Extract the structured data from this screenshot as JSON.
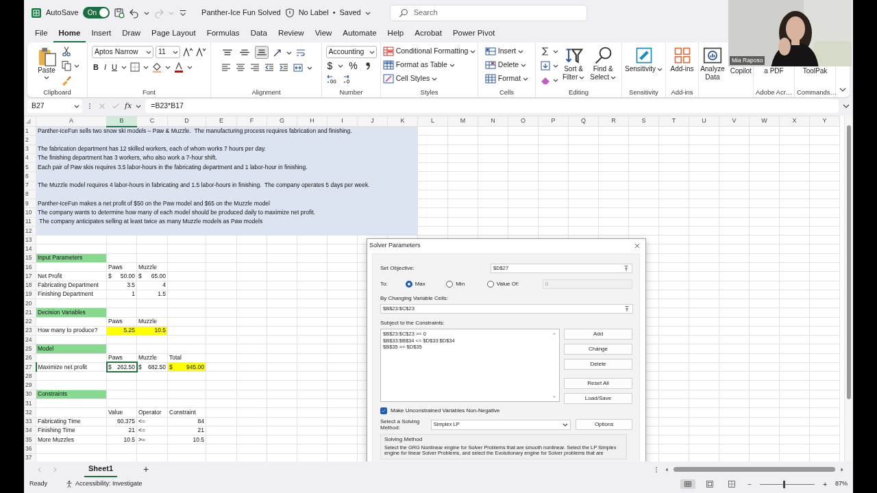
{
  "title_bar": {
    "autosave_label": "AutoSave",
    "autosave": {
      "on": true,
      "text": "On"
    },
    "file_name": "Panther-Ice Fun Solved",
    "sensitivity_label": "No Label",
    "separator": "•",
    "save_status": "Saved",
    "search": {
      "placeholder": "Search"
    }
  },
  "menu_tabs": [
    {
      "label": "File",
      "selected": false
    },
    {
      "label": "Home",
      "selected": true
    },
    {
      "label": "Insert",
      "selected": false
    },
    {
      "label": "Draw",
      "selected": false
    },
    {
      "label": "Page Layout",
      "selected": false
    },
    {
      "label": "Formulas",
      "selected": false
    },
    {
      "label": "Data",
      "selected": false
    },
    {
      "label": "Review",
      "selected": false
    },
    {
      "label": "View",
      "selected": false
    },
    {
      "label": "Automate",
      "selected": false
    },
    {
      "label": "Help",
      "selected": false
    },
    {
      "label": "Acrobat",
      "selected": false
    },
    {
      "label": "Power Pivot",
      "selected": false
    }
  ],
  "ribbon": {
    "groups": [
      {
        "kind": "clipboard",
        "label": "Clipboard",
        "paste": "Paste"
      },
      {
        "kind": "font",
        "label": "Font",
        "font_name": "Aptos Narrow",
        "font_size": "11",
        "bold": "B",
        "italic": "I",
        "underline": "U"
      },
      {
        "kind": "alignment",
        "label": "Alignment",
        "vertical": [
          {
            "selected": false
          },
          {
            "selected": false
          },
          {
            "selected": true
          }
        ]
      },
      {
        "kind": "number",
        "label": "Number",
        "format": "Accounting",
        "currency": "$",
        "percent": "%"
      },
      {
        "kind": "list",
        "label": "Styles",
        "items": [
          "Conditional Formatting",
          "Format as Table",
          "Cell Styles"
        ]
      },
      {
        "kind": "list",
        "label": "Cells",
        "items": [
          "Insert",
          "Delete",
          "Format"
        ]
      },
      {
        "kind": "editing",
        "label": "Editing",
        "buttons": [
          {
            "lines": [
              "Sort &",
              "Filter"
            ],
            "menu": true
          },
          {
            "lines": [
              "Find &",
              "Select"
            ],
            "menu": true
          }
        ]
      },
      {
        "kind": "large",
        "label": "Sensitivity",
        "buttons": [
          {
            "lines": [
              "Sensitivity"
            ],
            "menu": true
          }
        ]
      },
      {
        "kind": "large",
        "label": "Add-ins",
        "buttons": [
          {
            "lines": [
              "Add-ins"
            ],
            "menu": false
          }
        ]
      },
      {
        "kind": "large",
        "buttons": [
          {
            "lines": [
              "Analyze",
              "Data"
            ],
            "menu": false
          },
          {
            "lines": [
              "Copilot"
            ],
            "menu": false
          }
        ]
      },
      {
        "kind": "large",
        "label": "Adobe Acr…",
        "buttons": [
          {
            "lines": [
              "a PDF"
            ],
            "menu": false
          }
        ]
      },
      {
        "kind": "large",
        "label": "Commands…",
        "buttons": [
          {
            "lines": [
              "ToolPak"
            ],
            "menu": false
          }
        ]
      }
    ]
  },
  "formula_bar": {
    "name_box": "B27",
    "function_label": "fx",
    "formula": "=B23*B17"
  },
  "sheet": {
    "columns": [
      "A",
      "B",
      "C",
      "D",
      "E",
      "F",
      "G",
      "H",
      "I",
      "J",
      "K",
      "L",
      "M",
      "N",
      "O",
      "P",
      "Q",
      "R",
      "S",
      "T",
      "U",
      "V",
      "W",
      "X",
      "Y"
    ],
    "rows": [
      {
        "number": "1",
        "shaded": true,
        "cells": [
          {
            "kind": "text",
            "text": "Panther-IceFun sells two snow ski models – Paw & Muzzle.  The manufacturing process requires fabrication and finishing.",
            "colspan": 11,
            "selected": false
          }
        ]
      },
      {
        "number": "2",
        "shaded": true,
        "cells": []
      },
      {
        "number": "3",
        "shaded": true,
        "cells": [
          {
            "kind": "text",
            "text": "The fabrication department has 12 skilled workers, each of whom works 7 hours per day.",
            "colspan": 11,
            "selected": false
          }
        ]
      },
      {
        "number": "4",
        "shaded": true,
        "cells": [
          {
            "kind": "text",
            "text": "The finishing department has 3 workers, who also work a 7-hour shift.",
            "colspan": 11,
            "selected": false
          }
        ]
      },
      {
        "number": "5",
        "shaded": true,
        "cells": [
          {
            "kind": "text",
            "text": "Each pair of Paw skis requires 3.5 labor-hours in the fabricating department and 1 labor-hour in finishing.",
            "colspan": 11,
            "selected": false
          }
        ]
      },
      {
        "number": "6",
        "shaded": true,
        "cells": []
      },
      {
        "number": "7",
        "shaded": true,
        "cells": [
          {
            "kind": "text",
            "text": "The Muzzle model requires 4 labor-hours in fabricating and 1.5 labor-hours in finishing.  The company operates 5 days per week.",
            "colspan": 11,
            "selected": false
          }
        ]
      },
      {
        "number": "8",
        "shaded": true,
        "cells": []
      },
      {
        "number": "9",
        "shaded": true,
        "cells": [
          {
            "kind": "text",
            "text": "Panther-IceFun makes a net profit of $50 on the Paw model and $65 on the Muzzle model",
            "colspan": 11,
            "selected": false
          }
        ]
      },
      {
        "number": "10",
        "shaded": true,
        "cells": [
          {
            "kind": "text",
            "text": "The company wants to determine how many of each model should be produced daily to maximize net profit.",
            "colspan": 11,
            "selected": false
          }
        ]
      },
      {
        "number": "11",
        "shaded": true,
        "cells": [
          {
            "kind": "text",
            "text": " The company anticipates selling at least twice as many Muzzle models as Paw models",
            "colspan": 11,
            "selected": false
          }
        ]
      },
      {
        "number": "12",
        "shaded": true,
        "cells": []
      },
      {
        "number": "13",
        "shaded": false,
        "cells": []
      },
      {
        "number": "14",
        "shaded": false,
        "cells": []
      },
      {
        "number": "15",
        "shaded": false,
        "cells": [
          {
            "kind": "section",
            "text": "Input Parameters",
            "selected": false
          }
        ]
      },
      {
        "number": "16",
        "shaded": false,
        "cells": [
          null,
          {
            "kind": "text",
            "text": "Paws",
            "selected": false
          },
          {
            "kind": "text",
            "text": "Muzzle",
            "selected": false
          }
        ]
      },
      {
        "number": "17",
        "shaded": false,
        "cells": [
          {
            "kind": "text",
            "text": "Net Profit",
            "selected": false
          },
          {
            "kind": "currency",
            "symbol": "$",
            "text": "50.00",
            "selected": false
          },
          {
            "kind": "currency",
            "symbol": "$",
            "text": "65.00",
            "selected": false
          }
        ]
      },
      {
        "number": "18",
        "shaded": false,
        "cells": [
          {
            "kind": "text",
            "text": "Fabricating Department",
            "selected": false
          },
          {
            "kind": "number",
            "text": "3.5",
            "selected": false
          },
          {
            "kind": "number",
            "text": "4",
            "selected": false
          }
        ]
      },
      {
        "number": "19",
        "shaded": false,
        "cells": [
          {
            "kind": "text",
            "text": "Finishing Department",
            "selected": false
          },
          {
            "kind": "number",
            "text": "1",
            "selected": false
          },
          {
            "kind": "number",
            "text": "1.5",
            "selected": false
          }
        ]
      },
      {
        "number": "20",
        "shaded": false,
        "cells": []
      },
      {
        "number": "21",
        "shaded": false,
        "cells": [
          {
            "kind": "section",
            "text": "Decision Variables",
            "selected": false
          }
        ]
      },
      {
        "number": "22",
        "shaded": false,
        "cells": [
          null,
          {
            "kind": "text",
            "text": "Paws",
            "selected": false
          },
          {
            "kind": "text",
            "text": "Muzzle",
            "selected": false
          }
        ]
      },
      {
        "number": "23",
        "shaded": false,
        "cells": [
          {
            "kind": "text",
            "text": "How many to produce?",
            "selected": false
          },
          {
            "kind": "input",
            "text": "5.25",
            "selected": false
          },
          {
            "kind": "input",
            "text": "10.5",
            "selected": false
          }
        ]
      },
      {
        "number": "24",
        "shaded": false,
        "cells": []
      },
      {
        "number": "25",
        "shaded": false,
        "cells": [
          {
            "kind": "section",
            "text": "Model",
            "selected": false
          }
        ]
      },
      {
        "number": "26",
        "shaded": false,
        "cells": [
          null,
          {
            "kind": "text",
            "text": "Paws",
            "selected": false
          },
          {
            "kind": "text",
            "text": "Muzzle",
            "selected": false
          },
          {
            "kind": "text",
            "text": "Total",
            "selected": false
          }
        ]
      },
      {
        "number": "27",
        "shaded": false,
        "cells": [
          {
            "kind": "text",
            "text": "Maximize net profit",
            "selected": false
          },
          {
            "kind": "currency",
            "symbol": "$",
            "text": "262.50",
            "selected": true
          },
          {
            "kind": "currency",
            "symbol": "$",
            "text": "682.50",
            "selected": false
          },
          {
            "kind": "input_currency",
            "symbol": "$",
            "text": "945.00",
            "selected": false
          }
        ]
      },
      {
        "number": "28",
        "shaded": false,
        "cells": []
      },
      {
        "number": "29",
        "shaded": false,
        "cells": []
      },
      {
        "number": "30",
        "shaded": false,
        "cells": [
          {
            "kind": "section",
            "text": "Constraints",
            "selected": false
          }
        ]
      },
      {
        "number": "31",
        "shaded": false,
        "cells": []
      },
      {
        "number": "32",
        "shaded": false,
        "cells": [
          null,
          {
            "kind": "text",
            "text": "Value",
            "selected": false
          },
          {
            "kind": "text",
            "text": "Operator",
            "selected": false
          },
          {
            "kind": "text",
            "text": "Constraint",
            "selected": false
          }
        ]
      },
      {
        "number": "33",
        "shaded": false,
        "cells": [
          {
            "kind": "text",
            "text": "Fabricating Time",
            "selected": false
          },
          {
            "kind": "number",
            "text": "60.375",
            "selected": false
          },
          {
            "kind": "text",
            "text": "<=",
            "selected": false
          },
          {
            "kind": "number",
            "text": "84",
            "selected": false
          }
        ]
      },
      {
        "number": "34",
        "shaded": false,
        "cells": [
          {
            "kind": "text",
            "text": "Finishing Time",
            "selected": false
          },
          {
            "kind": "number",
            "text": "21",
            "selected": false
          },
          {
            "kind": "text",
            "text": "<=",
            "selected": false
          },
          {
            "kind": "number",
            "text": "21",
            "selected": false
          }
        ]
      },
      {
        "number": "35",
        "shaded": false,
        "cells": [
          {
            "kind": "text",
            "text": "More Muzzles",
            "selected": false
          },
          {
            "kind": "number",
            "text": "10.5",
            "selected": false
          },
          {
            "kind": "text",
            "text": ">=",
            "selected": false
          },
          {
            "kind": "number",
            "text": "10.5",
            "selected": false
          }
        ]
      },
      {
        "number": "36",
        "shaded": false,
        "cells": []
      },
      {
        "number": "37",
        "shaded": false,
        "cells": []
      }
    ]
  },
  "solver_dialog": {
    "title": "Solver Parameters",
    "objective_label": "Set Objective:",
    "objective": "$D$27",
    "to_label": "To:",
    "to_options": [
      {
        "label": "Max",
        "selected": true
      },
      {
        "label": "Min",
        "selected": false
      },
      {
        "label": "Value Of:",
        "selected": false
      }
    ],
    "value_of": {
      "value": "0",
      "disabled": true
    },
    "variables_label": "By Changing Variable Cells:",
    "variables": "$B$23:$C$23",
    "constraints_label": "Subject to the Constraints:",
    "constraints": [
      "$B$23:$C$23 >= 0",
      "$B$33:$B$34 <= $D$33:$D$34",
      "$B$35 >= $D$35"
    ],
    "buttons": [
      "Add",
      "Change",
      "Delete",
      "Reset All",
      "Load/Save"
    ],
    "nonnegative": {
      "label": "Make Unconstrained Variables Non-Negative",
      "checked": true
    },
    "method_label": "Select a Solving Method:",
    "method": "Simplex LP",
    "options_button": "Options",
    "method_box": {
      "title": "Solving Method",
      "lines": [
        "Select the GRG Nonlinear engine for Solver Problems that are smooth nonlinear. Select the LP Simplex",
        "engine for linear Solver Problems, and select the Evolutionary engine for Solver problems that are"
      ]
    }
  },
  "sheet_tabs": {
    "sheets": [
      {
        "label": "Sheet1",
        "selected": true
      }
    ],
    "add": "+"
  },
  "status_bar": {
    "status": "Ready",
    "accessibility": "Accessibility: Investigate",
    "views": [
      {
        "selected": true
      },
      {
        "selected": false
      },
      {
        "selected": false
      }
    ],
    "zoom_out": "−",
    "zoom": {
      "level": 0.44
    },
    "zoom_in": "+",
    "zoom_reading": "87%"
  },
  "webcam": {
    "kind": "picture",
    "name": "Mia Raposo"
  }
}
